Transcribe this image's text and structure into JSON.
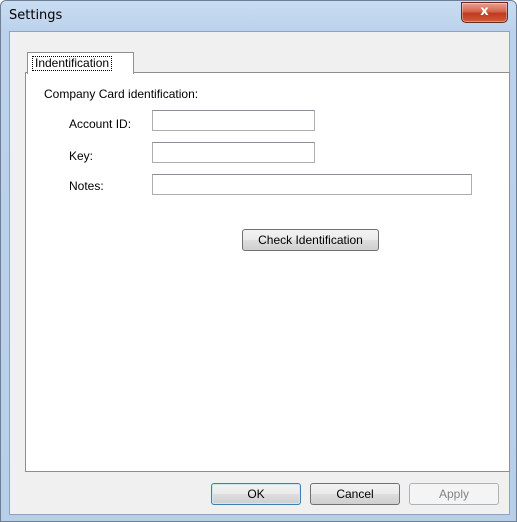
{
  "window": {
    "title": "Settings",
    "close_label": "x"
  },
  "tabs": [
    {
      "label": "Indentification",
      "selected": true
    }
  ],
  "form": {
    "group_label": "Company Card identification:",
    "fields": [
      {
        "label": "Account ID:",
        "value": ""
      },
      {
        "label": "Key:",
        "value": ""
      },
      {
        "label": "Notes:",
        "value": ""
      }
    ],
    "check_button": "Check Identification"
  },
  "buttons": {
    "ok": "OK",
    "cancel": "Cancel",
    "apply": "Apply"
  },
  "colors": {
    "frame": "#b9d1ea",
    "close_button": "#c7452b",
    "default_button_border": "#3c7fb1"
  }
}
